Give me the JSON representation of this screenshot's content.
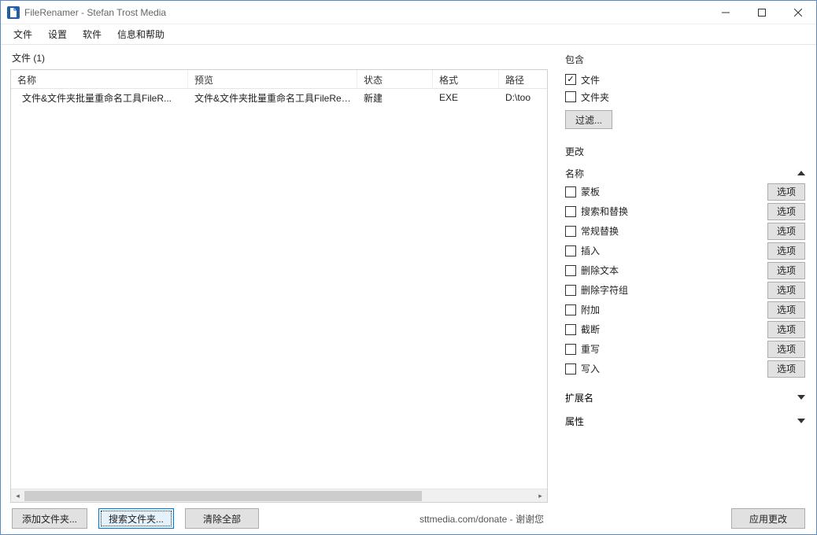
{
  "window": {
    "title": "FileRenamer - Stefan Trost Media"
  },
  "menu": {
    "items": [
      "文件",
      "设置",
      "软件",
      "信息和帮助"
    ]
  },
  "files": {
    "header": "文件 (1)",
    "columns": {
      "name": "名称",
      "preview": "预览",
      "status": "状态",
      "format": "格式",
      "path": "路径"
    },
    "rows": [
      {
        "name": "文件&文件夹批量重命名工具FileR...",
        "preview": "文件&文件夹批量重命名工具FileRen...",
        "status": "新建",
        "format": "EXE",
        "path": "D:\\too"
      }
    ]
  },
  "include": {
    "title": "包含",
    "files": {
      "label": "文件",
      "checked": true
    },
    "folders": {
      "label": "文件夹",
      "checked": false
    },
    "filter_btn": "过滤..."
  },
  "change": {
    "title": "更改",
    "name_section": {
      "label": "名称",
      "expanded": true,
      "options": [
        {
          "label": "蒙板",
          "checked": false
        },
        {
          "label": "搜索和替换",
          "checked": false
        },
        {
          "label": "常规替换",
          "checked": false
        },
        {
          "label": "插入",
          "checked": false
        },
        {
          "label": "删除文本",
          "checked": false
        },
        {
          "label": "删除字符组",
          "checked": false
        },
        {
          "label": "附加",
          "checked": false
        },
        {
          "label": "截断",
          "checked": false
        },
        {
          "label": "重写",
          "checked": false
        },
        {
          "label": "写入",
          "checked": false
        }
      ],
      "option_btn": "选项"
    },
    "ext_section": {
      "label": "扩展名",
      "expanded": false
    },
    "attr_section": {
      "label": "属性",
      "expanded": false
    }
  },
  "bottom": {
    "add_folder": "添加文件夹...",
    "search_folder": "搜索文件夹...",
    "clear_all": "清除全部",
    "donate": "sttmedia.com/donate - 谢谢您",
    "apply": "应用更改"
  }
}
